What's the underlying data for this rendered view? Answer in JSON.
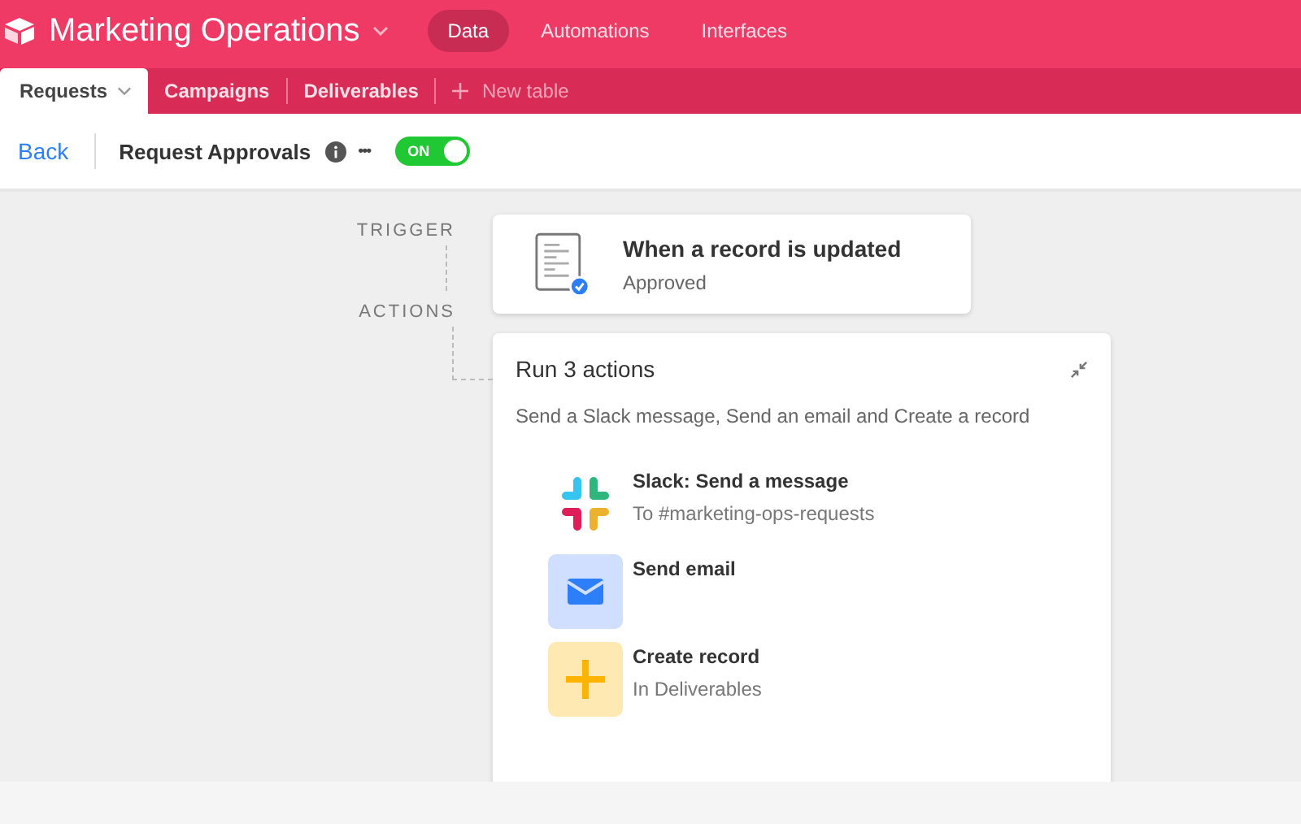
{
  "base": {
    "title": "Marketing Operations"
  },
  "nav": [
    {
      "label": "Data",
      "selected": true
    },
    {
      "label": "Automations",
      "selected": false
    },
    {
      "label": "Interfaces",
      "selected": false
    }
  ],
  "tables": [
    {
      "label": "Requests",
      "selected": true
    },
    {
      "label": "Campaigns",
      "selected": false
    },
    {
      "label": "Deliverables",
      "selected": false
    }
  ],
  "new_table": "New table",
  "toolbar": {
    "back": "Back",
    "title": "Request Approvals",
    "more": "•••",
    "toggle": {
      "label": "ON",
      "on": true
    }
  },
  "trigger": {
    "label": "TRIGGER",
    "title": "When a record is updated",
    "subtitle": "Approved"
  },
  "actions": {
    "label": "ACTIONS",
    "title": "Run 3 actions",
    "description": "Send a Slack message, Send an email and Create a record",
    "items": [
      {
        "kind": "slack",
        "title": "Slack: Send a message",
        "subtitle": "To #marketing-ops-requests"
      },
      {
        "kind": "email",
        "title": "Send email"
      },
      {
        "kind": "record",
        "title": "Create record",
        "subtitle": "In Deliverables"
      }
    ]
  }
}
